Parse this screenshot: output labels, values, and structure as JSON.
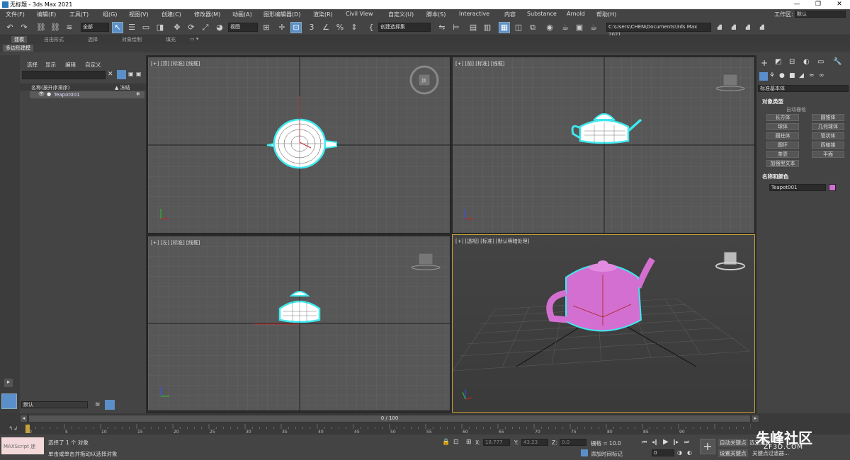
{
  "window": {
    "title": "无标题 - 3ds Max 2021",
    "min": "—",
    "max": "❐",
    "close": "✕"
  },
  "menu": [
    "文件(F)",
    "编辑(E)",
    "工具(T)",
    "组(G)",
    "视图(V)",
    "创建(C)",
    "修改器(M)",
    "动画(A)",
    "图形编辑器(D)",
    "渲染(R)",
    "Civil View",
    "自定义(U)",
    "脚本(S)",
    "Interactive",
    "内容",
    "Substance",
    "Arnold",
    "帮助(H)"
  ],
  "workspace": {
    "label": "工作区:",
    "value": "默认"
  },
  "toolbar": {
    "filter": "全部",
    "refcoord": "视图",
    "selset": "创建选择集",
    "path": "C:\\Users\\CHEN\\Documents\\3ds Max 2021"
  },
  "ribbon": {
    "tabs": [
      "建模",
      "自由形式",
      "选择",
      "对象绘制",
      "填充"
    ],
    "sub": "多边形建模"
  },
  "explorer": {
    "tabs": [
      "选择",
      "显示",
      "编辑",
      "自定义"
    ],
    "col_name": "名称(按升序排序)",
    "col_freeze": "▲ 冻结",
    "row": "Teapot001",
    "layer": "默认"
  },
  "viewports": {
    "top": "[+] [顶] [标准] [线框]",
    "front": "[+] [前] [标准] [线框]",
    "left": "[+] [左] [标准] [线框]",
    "persp": "[+] [透视] [标准] [默认明暗处理]",
    "cube_top": "顶"
  },
  "cmd": {
    "category": "标准基本体",
    "rollout1": "对象类型",
    "autogrid": "自动栅格",
    "buttons": [
      "长方体",
      "圆锥体",
      "球体",
      "几何球体",
      "圆柱体",
      "管状体",
      "圆环",
      "四棱锥",
      "茶壶",
      "平面",
      "加强型文本"
    ],
    "rollout2": "名称和颜色",
    "objname": "Teapot001",
    "objcolor": "#d36fd0"
  },
  "timeline": {
    "slider": "0 / 100",
    "ticks": [
      "0",
      "5",
      "10",
      "15",
      "20",
      "25",
      "30",
      "35",
      "40",
      "45",
      "50",
      "55",
      "60",
      "65",
      "70",
      "75",
      "80",
      "85",
      "90"
    ]
  },
  "status": {
    "maxscript": "MAXScript 迷",
    "line1": "选择了 1 个 对象",
    "line2": "单击或单击并拖动以选择对象",
    "x_label": "X:",
    "x": "18.777",
    "y_label": "Y:",
    "y": "43.23",
    "z_label": "Z:",
    "z": "0.0",
    "grid": "栅格 = 10.0",
    "addtime": "添加时间标记",
    "autokey": "自动关键点",
    "setkey": "设置关键点",
    "selected": "选定对象",
    "filters": "关键点过滤器...",
    "frame": "0"
  },
  "watermark": {
    "brand": "朱峰社区",
    "site": "ZF3D.COM"
  }
}
